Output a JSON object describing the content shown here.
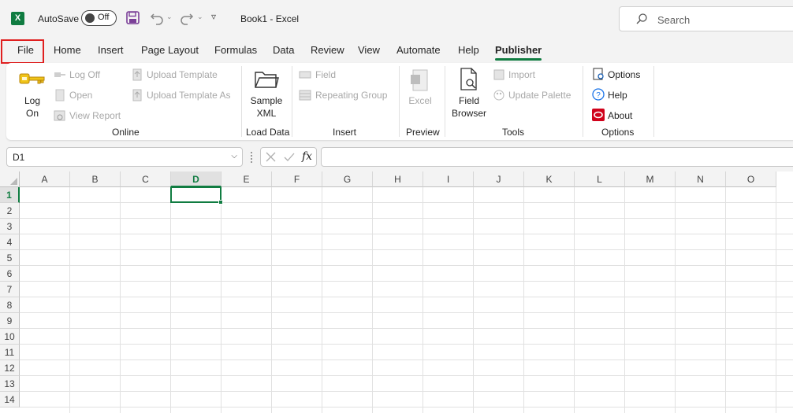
{
  "app": {
    "logo_letter": "X",
    "autosave_label": "AutoSave",
    "autosave_state": "Off",
    "doc_title": "Book1  -  Excel"
  },
  "search": {
    "placeholder": "Search"
  },
  "tabs": [
    "File",
    "Home",
    "Insert",
    "Page Layout",
    "Formulas",
    "Data",
    "Review",
    "View",
    "Automate",
    "Help",
    "Publisher"
  ],
  "active_tab": "Publisher",
  "ribbon": {
    "online": {
      "log_on_1": "Log",
      "log_on_2": "On",
      "log_off": "Log Off",
      "open": "Open",
      "view_report": "View Report",
      "upload_template": "Upload Template",
      "upload_template_as": "Upload Template As",
      "label": "Online"
    },
    "load_data": {
      "sample_1": "Sample",
      "sample_2": "XML",
      "label": "Load Data"
    },
    "insert": {
      "field": "Field",
      "repeating_group": "Repeating Group",
      "label": "Insert"
    },
    "preview": {
      "excel": "Excel",
      "label": "Preview"
    },
    "tools": {
      "field_browser_1": "Field",
      "field_browser_2": "Browser",
      "import": "Import",
      "update_palette": "Update Palette",
      "label": "Tools"
    },
    "options": {
      "options": "Options",
      "help": "Help",
      "about": "About",
      "label": "Options"
    }
  },
  "formula_bar": {
    "name_box": "D1",
    "fx": "fx",
    "value": ""
  },
  "sheet": {
    "columns": [
      "A",
      "B",
      "C",
      "D",
      "E",
      "F",
      "G",
      "H",
      "I",
      "J",
      "K",
      "L",
      "M",
      "N",
      "O"
    ],
    "rows": [
      "1",
      "2",
      "3",
      "4",
      "5",
      "6",
      "7",
      "8",
      "9",
      "10",
      "11",
      "12",
      "13",
      "14"
    ],
    "active_cell": "D1"
  },
  "colors": {
    "accent": "#107c41",
    "highlight": "#e02020"
  }
}
